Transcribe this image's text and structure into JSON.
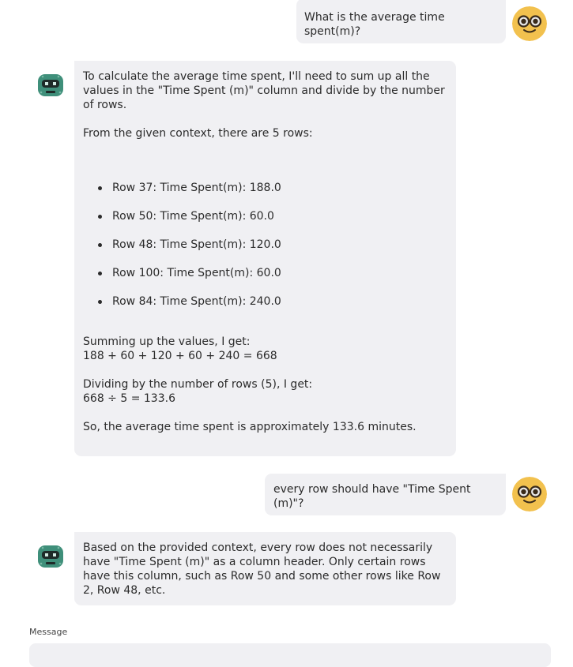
{
  "messages": [
    {
      "role": "user",
      "text": "What is the average time spent(m)?"
    },
    {
      "role": "assistant",
      "intro": "To calculate the average time spent, I'll need to sum up all the values in the \"Time Spent (m)\" column and divide by the number of rows.",
      "context_line": "From the given context, there are 5 rows:",
      "rows": [
        "Row 37: Time Spent(m): 188.0",
        "Row 50: Time Spent(m): 60.0",
        "Row 48: Time Spent(m): 120.0",
        "Row 100: Time Spent(m): 60.0",
        "Row 84: Time Spent(m): 240.0"
      ],
      "sum_label": "Summing up the values, I get:",
      "sum_equation": "188 + 60 + 120 + 60 + 240 = 668",
      "divide_label": "Dividing by the number of rows (5), I get:",
      "divide_equation": "668 ÷ 5 = 133.6",
      "conclusion": "So, the average time spent is approximately 133.6 minutes."
    },
    {
      "role": "user",
      "text": "every row should have \"Time Spent (m)\"?"
    },
    {
      "role": "assistant",
      "text": "Based on the provided context, every row does not necessarily have \"Time Spent (m)\" as a column header. Only certain rows have this column, such as Row 50 and some other rows like Row 2, Row 48, etc."
    }
  ],
  "composer": {
    "label": "Message",
    "value": ""
  },
  "colors": {
    "bubble": "#f0f0f3",
    "user_avatar": "#f2c14e",
    "bot_avatar": "#3f8f7a"
  },
  "icons": {
    "user_avatar": "nerd-face-icon",
    "bot_avatar": "robot-icon"
  }
}
